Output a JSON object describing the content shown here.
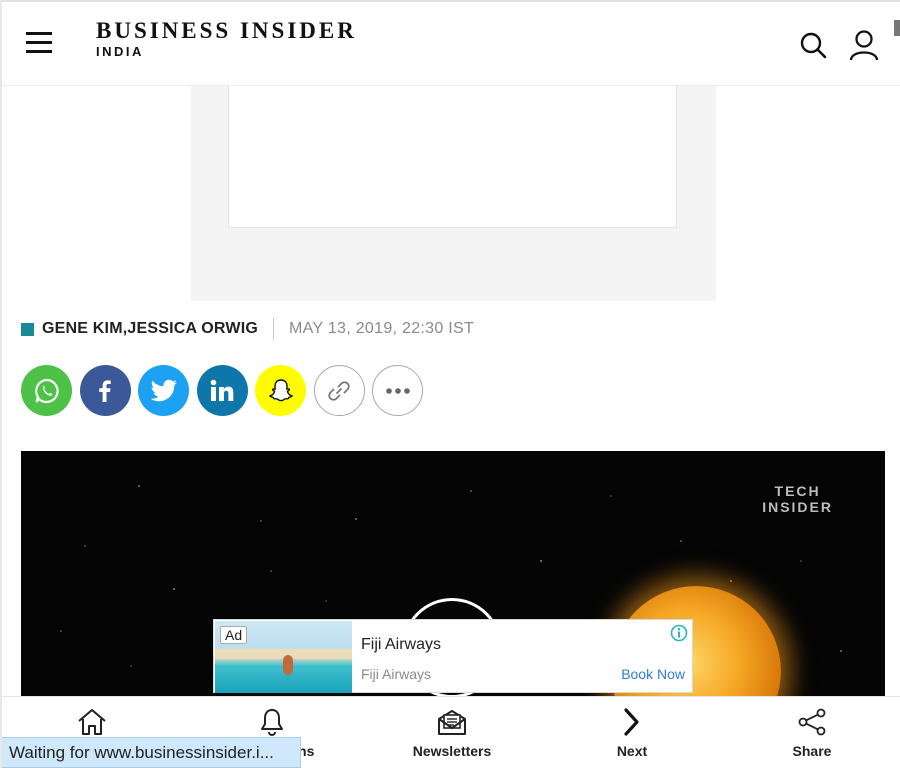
{
  "header": {
    "logo_line1": "BUSINESS INSIDER",
    "logo_line2": "INDIA",
    "icons": [
      "hamburger-menu-icon",
      "search-icon",
      "user-icon"
    ]
  },
  "article": {
    "authors": "GENE KIM,JESSICA ORWIG",
    "date": "MAY 13, 2019, 22:30 IST",
    "accent_color": "#1a8a9a"
  },
  "share": {
    "buttons": [
      {
        "name": "whatsapp-icon",
        "color": "#4dc247"
      },
      {
        "name": "facebook-icon",
        "color": "#3b5998"
      },
      {
        "name": "twitter-icon",
        "color": "#1da1f2"
      },
      {
        "name": "linkedin-icon",
        "color": "#0e76a8"
      },
      {
        "name": "snapchat-icon",
        "color": "#fffc00"
      },
      {
        "name": "link-icon",
        "color": "#ffffff"
      },
      {
        "name": "more-icon",
        "color": "#ffffff"
      }
    ]
  },
  "video": {
    "watermark_line1": "TECH",
    "watermark_line2": "INSIDER"
  },
  "ad": {
    "tag": "Ad",
    "title": "Fiji Airways",
    "sponsor": "Fiji Airways",
    "cta": "Book Now",
    "cta_color": "#2d7dd2"
  },
  "bottom_nav": {
    "items": [
      {
        "label": "",
        "icon": "home-icon"
      },
      {
        "label": "Notifications",
        "icon": "bell-icon"
      },
      {
        "label": "Newsletters",
        "icon": "newsletter-icon"
      },
      {
        "label": "Next",
        "icon": "chevron-right-icon"
      },
      {
        "label": "Share",
        "icon": "share-icon"
      }
    ]
  },
  "status_bar": {
    "text": "Waiting for www.businessinsider.i..."
  }
}
